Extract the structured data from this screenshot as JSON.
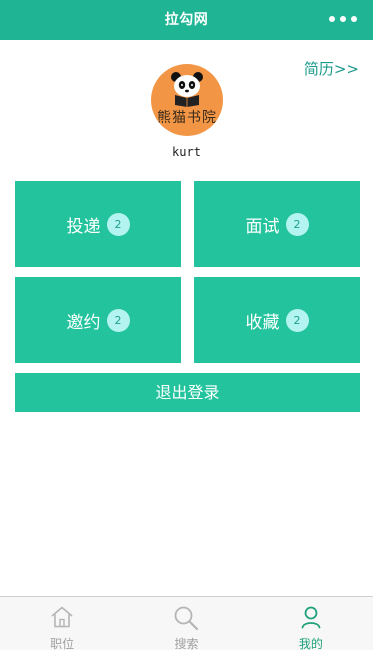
{
  "header": {
    "title": "拉勾网",
    "more_icon": "more-dots-icon"
  },
  "profile": {
    "resume_link": "简历>>",
    "avatar_logo_text": "熊猫书院",
    "username": "kurt"
  },
  "tiles": [
    {
      "label": "投递",
      "count": "2"
    },
    {
      "label": "面试",
      "count": "2"
    },
    {
      "label": "邀约",
      "count": "2"
    },
    {
      "label": "收藏",
      "count": "2"
    }
  ],
  "logout_label": "退出登录",
  "tabbar": {
    "items": [
      {
        "label": "职位",
        "icon": "home-icon",
        "active": false
      },
      {
        "label": "搜索",
        "icon": "search-icon",
        "active": false
      },
      {
        "label": "我的",
        "icon": "user-icon",
        "active": true
      }
    ]
  },
  "colors": {
    "brand": "#1fb594",
    "tile": "#23c49d",
    "badge_bg": "#b3f3f0",
    "active_tab": "#1fa17b",
    "avatar_bg": "#f29646"
  }
}
